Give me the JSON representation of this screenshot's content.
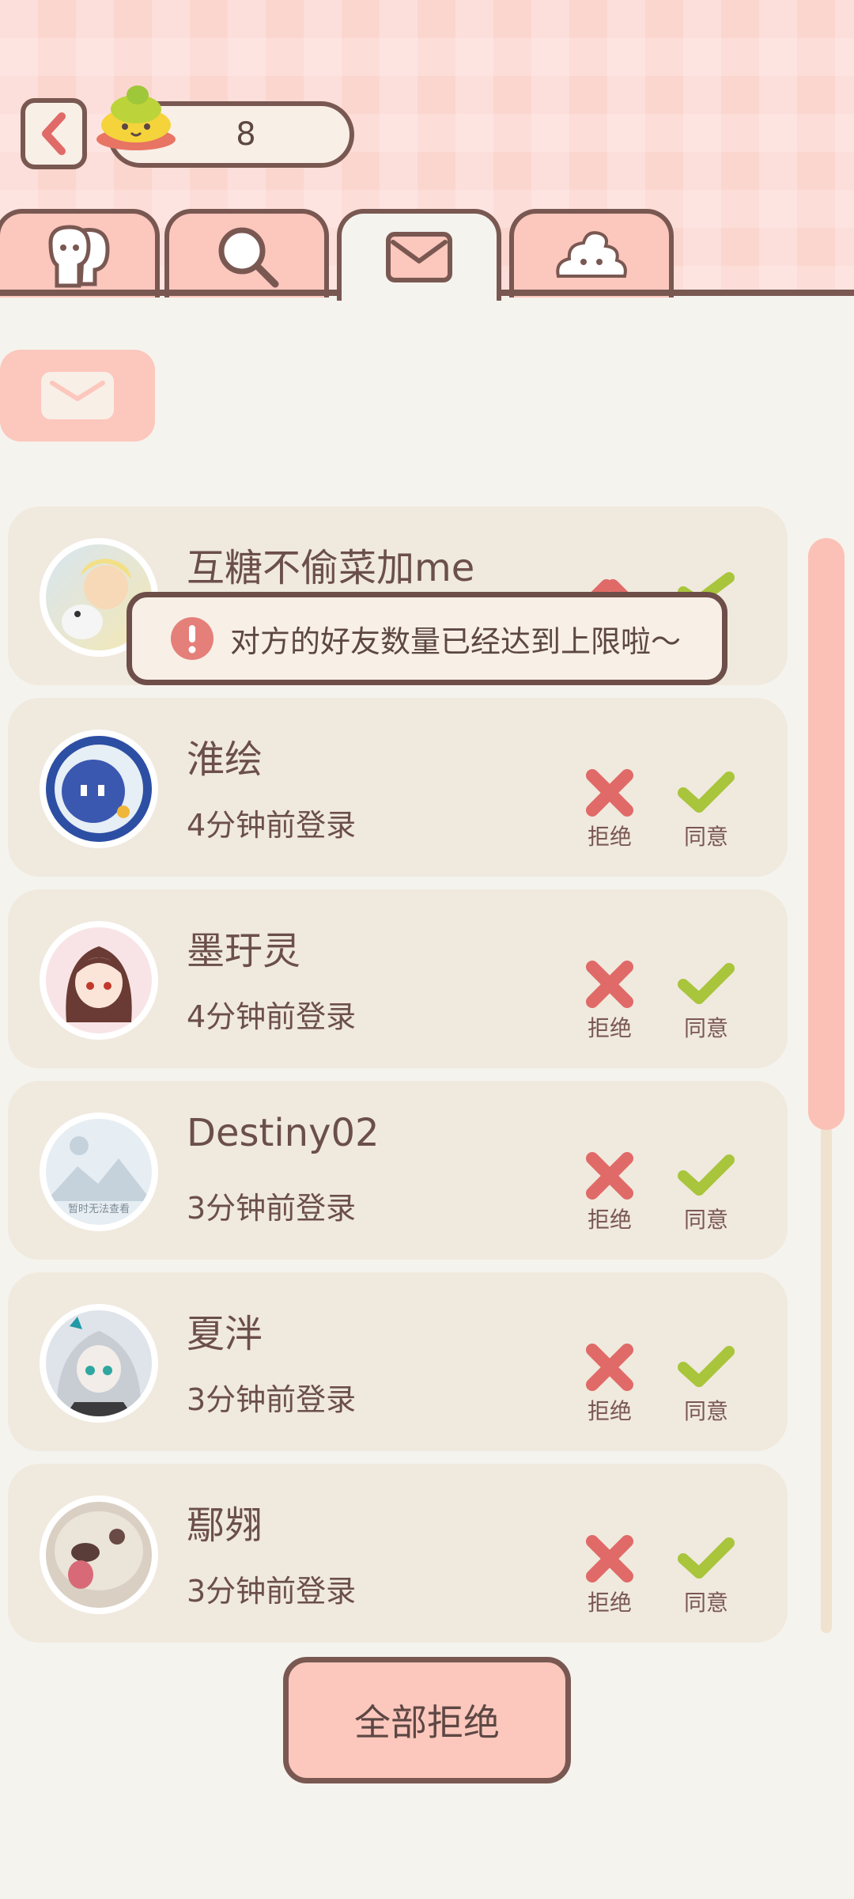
{
  "header": {
    "coins": "8"
  },
  "tabs": [
    {
      "name": "friends",
      "icon": "friends-icon"
    },
    {
      "name": "search",
      "icon": "search-icon"
    },
    {
      "name": "mail",
      "icon": "mail-icon",
      "active": true
    },
    {
      "name": "poop",
      "icon": "poop-icon"
    }
  ],
  "toast": {
    "text": "对方的好友数量已经达到上限啦～"
  },
  "requests": [
    {
      "name": "互糖不偷菜加me",
      "login": "",
      "avatar_colors": [
        "#d8e6f1",
        "#f4e7b3"
      ]
    },
    {
      "name": "淮绘",
      "login": "4分钟前登录",
      "avatar_colors": [
        "#2d4fa3",
        "#6c8ed8"
      ]
    },
    {
      "name": "墨玗灵",
      "login": "4分钟前登录",
      "avatar_colors": [
        "#f8e4e6",
        "#6a3a34"
      ]
    },
    {
      "name": "Destiny02",
      "login": "3分钟前登录",
      "avatar_colors": [
        "#e6eef3",
        "#c5d2dc"
      ],
      "avatar_text": "暂时无法查看"
    },
    {
      "name": "夏泮",
      "login": "3分钟前登录",
      "avatar_colors": [
        "#3b3a3d",
        "#dfe4ea"
      ]
    },
    {
      "name": "鄢翙",
      "login": "3分钟前登录",
      "avatar_colors": [
        "#d9d0c3",
        "#b78a83"
      ]
    }
  ],
  "actions": {
    "reject_label": "拒绝",
    "agree_label": "同意"
  },
  "footer": {
    "reject_all_label": "全部拒绝"
  },
  "colors": {
    "accent": "#fcc7bd",
    "outline": "#7a5852",
    "reject": "#e06a67",
    "agree": "#a8c53b",
    "card": "#f0e9de",
    "background": "#f5f3ee"
  }
}
